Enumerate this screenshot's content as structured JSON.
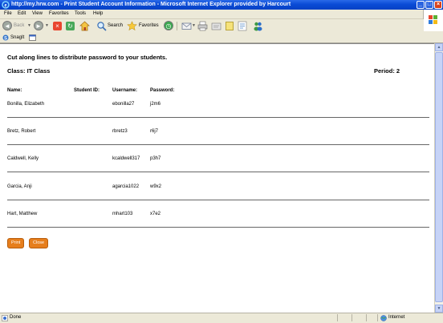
{
  "window": {
    "title": "http://my.hrw.com - Print Student Account Information - Microsoft Internet Explorer provided by Harcourt"
  },
  "menu": [
    "File",
    "Edit",
    "View",
    "Favorites",
    "Tools",
    "Help"
  ],
  "toolbar": {
    "back_label": "Back",
    "search_label": "Search",
    "favorites_label": "Favorites"
  },
  "links": {
    "snagit_label": "SnagIt"
  },
  "page": {
    "instruction": "Cut along lines to distribute password to your students.",
    "class_label": "Class: IT Class",
    "period_label": "Period: 2",
    "columns": [
      "Name:",
      "Student ID:",
      "Username:",
      "Password:"
    ],
    "students": [
      {
        "name": "Bonilla, Elizabeth",
        "student_id": "",
        "username": "ebonilla27",
        "password": "j2m6"
      },
      {
        "name": "Bretz, Robert",
        "student_id": "",
        "username": "rbretz3",
        "password": "r6j7"
      },
      {
        "name": "Caldwell, Kelly",
        "student_id": "",
        "username": "kcaldwell317",
        "password": "p3h7"
      },
      {
        "name": "Garcia, Anji",
        "student_id": "",
        "username": "agarcia1022",
        "password": "w9x2"
      },
      {
        "name": "Hart, Matthew",
        "student_id": "",
        "username": "mhart103",
        "password": "x7e2"
      }
    ],
    "print_label": "Print",
    "close_label": "Close"
  },
  "status": {
    "left": "Done",
    "zone": "Internet"
  },
  "colors": {
    "titlebar": "#0a4bd6",
    "button_orange": "#e67e1c"
  }
}
